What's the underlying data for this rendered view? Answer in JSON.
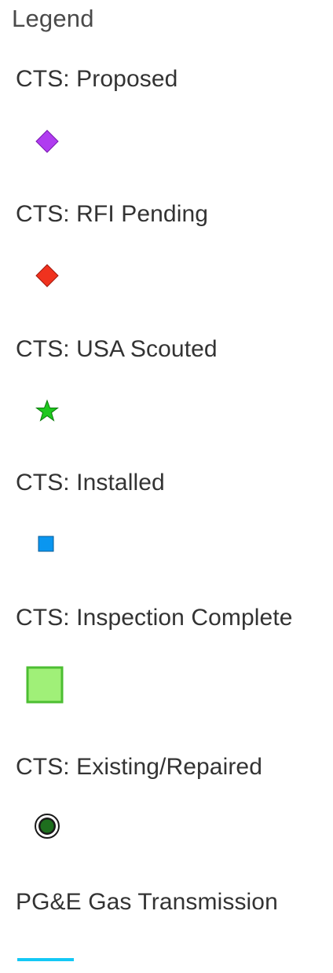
{
  "legend": {
    "title": "Legend",
    "layers": [
      {
        "label": "CTS: Proposed",
        "symbol": "diamond-icon",
        "color": "#b03cf0"
      },
      {
        "label": "CTS: RFI Pending",
        "symbol": "diamond-icon",
        "color": "#f0321e"
      },
      {
        "label": "CTS: USA Scouted",
        "symbol": "star-icon",
        "color": "#1ec81e"
      },
      {
        "label": "CTS: Installed",
        "symbol": "square-icon",
        "color": "#0a96f0"
      },
      {
        "label": "CTS: Inspection Complete",
        "symbol": "square-outline-icon",
        "color": "#a0f078",
        "stroke": "#4cbe32"
      },
      {
        "label": "CTS: Existing/Repaired",
        "symbol": "ring-dot-icon",
        "color": "#1e6e1e"
      },
      {
        "label": "PG&E Gas Transmission",
        "symbol": "line-icon",
        "color": "#14c8f5"
      }
    ]
  }
}
